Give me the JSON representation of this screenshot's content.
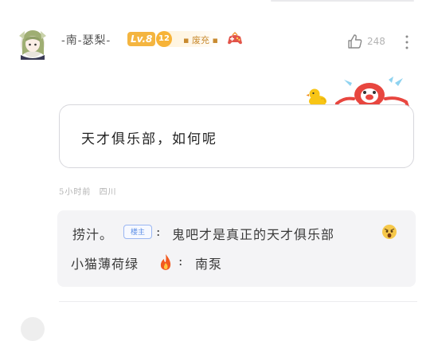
{
  "comment": {
    "user_name": "-南-瑟梨-",
    "level_badge": "Lv.8",
    "fan_badge_level": "12",
    "fan_badge_label": "▪ 废充 ▪",
    "like_count": "248",
    "text": "天才俱乐部，如何呢",
    "time_ago": "5小时前",
    "location": "四川"
  },
  "replies": [
    {
      "user": "捞汁。",
      "tag": "楼主",
      "text": "鬼吧才是真正的天才俱乐部"
    },
    {
      "user": "小猫薄荷绿",
      "text": "南泵"
    }
  ],
  "icons": {
    "like": "thumb-up-icon",
    "more": "more-vertical-icon",
    "gamepad": "gamepad-icon",
    "fire": "fire-icon",
    "emoji": "surprised-face-icon",
    "duck": "duck-sticker",
    "crab": "crab-sticker"
  },
  "colors": {
    "level_badge": "#f4b540",
    "fan_badge": "#f7b337",
    "tag_border": "#9ab6f2",
    "reply_bg": "#f4f4f6"
  }
}
